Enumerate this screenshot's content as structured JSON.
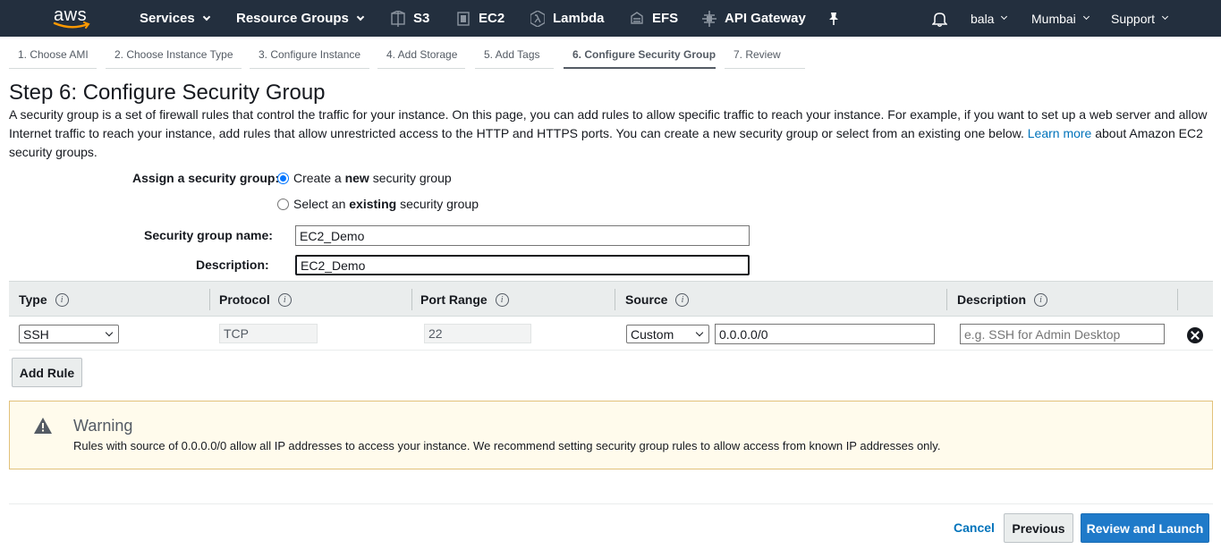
{
  "nav": {
    "logo_text": "aws",
    "services": "Services",
    "resource_groups": "Resource Groups",
    "shortcuts": [
      {
        "label": "S3",
        "icon": "s3-icon"
      },
      {
        "label": "EC2",
        "icon": "ec2-icon"
      },
      {
        "label": "Lambda",
        "icon": "lambda-icon"
      },
      {
        "label": "EFS",
        "icon": "efs-icon"
      },
      {
        "label": "API Gateway",
        "icon": "api-gateway-icon"
      }
    ],
    "user": "bala",
    "region": "Mumbai",
    "support": "Support"
  },
  "steps": [
    {
      "label": "1. Choose AMI",
      "active": false
    },
    {
      "label": "2. Choose Instance Type",
      "active": false
    },
    {
      "label": "3. Configure Instance",
      "active": false
    },
    {
      "label": "4. Add Storage",
      "active": false
    },
    {
      "label": "5. Add Tags",
      "active": false
    },
    {
      "label": "6. Configure Security Group",
      "active": true
    },
    {
      "label": "7. Review",
      "active": false
    }
  ],
  "page": {
    "title": "Step 6: Configure Security Group",
    "intro_text": "A security group is a set of firewall rules that control the traffic for your instance. On this page, you can add rules to allow specific traffic to reach your instance. For example, if you want to set up a web server and allow Internet traffic to reach your instance, add rules that allow unrestricted access to the HTTP and HTTPS ports. You can create a new security group or select from an existing one below.",
    "learn_more": "Learn more",
    "intro_suffix": "about Amazon EC2 security groups."
  },
  "assign": {
    "label": "Assign a security group:",
    "option_create_pre": "Create a",
    "option_create_bold": "new",
    "option_create_post": "security group",
    "option_existing_pre": "Select an",
    "option_existing_bold": "existing",
    "option_existing_post": "security group",
    "selected": "create"
  },
  "group": {
    "name_label": "Security group name:",
    "name_value": "EC2_Demo",
    "description_label": "Description:",
    "description_value": "EC2_Demo"
  },
  "table": {
    "headers": [
      "Type",
      "Protocol",
      "Port Range",
      "Source",
      "Description"
    ],
    "rows": [
      {
        "type": "SSH",
        "protocol": "TCP",
        "port_range": "22",
        "source_type": "Custom",
        "source_value": "0.0.0.0/0",
        "description_placeholder": "e.g. SSH for Admin Desktop"
      }
    ]
  },
  "add_rule": "Add Rule",
  "warning": {
    "title": "Warning",
    "text": "Rules with source of 0.0.0.0/0 allow all IP addresses to access your instance. We recommend setting security group rules to allow access from known IP addresses only."
  },
  "footer": {
    "cancel": "Cancel",
    "previous": "Previous",
    "review": "Review and Launch"
  },
  "colors": {
    "nav_bg": "#232f3e",
    "link": "#0073bb",
    "primary_button": "#1f7ac9",
    "warning_bg": "#fffbec",
    "warning_border": "#e2c17a"
  }
}
